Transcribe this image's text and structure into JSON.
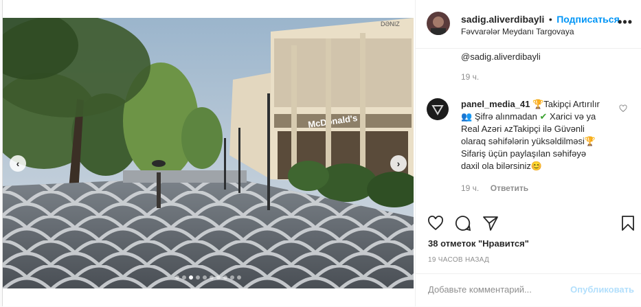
{
  "post": {
    "username": "sadig.aliverdibayli",
    "separator": "•",
    "follow_label": "Подписаться",
    "location": "Fəvvarələr Meydanı Targovaya",
    "more_label": "•••"
  },
  "photo": {
    "store_sign": "McDonald's",
    "bank_sign": "DƏNIZ",
    "slide_count": 10,
    "active_slide": 2
  },
  "caption": {
    "mention": "@sadig.aliverdibayli",
    "time": "19 ч."
  },
  "comment": {
    "username": "panel_media_41",
    "text_line1": "Takipçi Artırılır",
    "text_line2": "Şifrə alınmadan",
    "text_line2b": "Xarici və ya",
    "text_line3": "Real Azəri ᴀᴢTakipçi ilə Güvənli",
    "text_line4": "olaraq səhifələrin yüksəldilməsi",
    "text_line5": "Sifariş üçün paylaşılan səhifəyə",
    "text_line6": "daxil ola bilərsiniz",
    "time": "19 ч.",
    "reply_label": "Ответить"
  },
  "actions": {
    "icons": [
      "heart-icon",
      "comment-icon",
      "share-icon",
      "bookmark-icon"
    ]
  },
  "likes_text": "38 отметок \"Нравится\"",
  "timestamp": "19 ЧАСОВ НАЗАД",
  "comment_box": {
    "placeholder": "Добавьте комментарий...",
    "publish_label": "Опубликовать"
  },
  "colors": {
    "link": "#0095f6",
    "publish_disabled": "#b2dffc",
    "text": "#262626",
    "muted": "#8e8e8e"
  }
}
